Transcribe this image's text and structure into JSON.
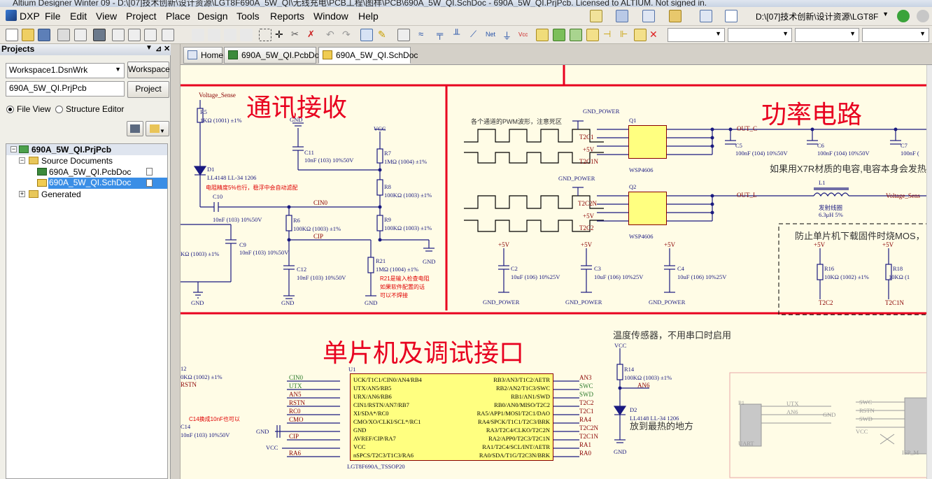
{
  "window": {
    "title": "Altium Designer Winter 09 - D:\\[07]技术创新\\设计资源\\LGT8F690A_5W_QI\\无线充电\\PCB工程\\图样\\PCB\\690A_5W_QI.SchDoc - 690A_5W_QI.PrjPcb. Licensed to ALTIUM. Not signed in."
  },
  "menu": [
    "DXP",
    "File",
    "Edit",
    "View",
    "Project",
    "Place",
    "Design",
    "Tools",
    "Reports",
    "Window",
    "Help"
  ],
  "path_combo": "D:\\[07]技术创新\\设计资源\\LGT8F",
  "projects_panel": {
    "title": "Projects",
    "workspace_value": "Workspace1.DsnWrk",
    "workspace_button": "Workspace",
    "project_value": "690A_5W_QI.PrjPcb",
    "project_button": "Project",
    "file_view": "File View",
    "structure_editor": "Structure Editor",
    "tree": {
      "project": "690A_5W_QI.PrjPcb",
      "source_documents": "Source Documents",
      "pcbdoc": "690A_5W_QI.PcbDoc",
      "schdoc": "690A_5W_QI.SchDoc",
      "generated": "Generated"
    }
  },
  "tabs": [
    "Home",
    "690A_5W_QI.PcbDoc",
    "690A_5W_QI.SchDoc"
  ],
  "schematic": {
    "section_titles": [
      "通讯接收",
      "功率电路",
      "单片机及调试接口"
    ],
    "notes": {
      "pwm": "各个通道的PWM波形，注意死区",
      "x7r": "如果用X7R材质的电容,电容本身会发热",
      "mos": "防止单片机下载固件时烧MOS，",
      "temp": "温度传感器，不用串口时启用",
      "hot": "放到最热的地方",
      "d1_note": "电阻精度5%也行，稳浮中会自动滤配",
      "r21_note1": "R21是输入检查电阻",
      "r21_note2": "如果软件配置的话",
      "r21_note3": "可以不焊接",
      "c14_note": "C14换成10nF也可以"
    },
    "labels": {
      "voltage_sense": "Voltage_Sense",
      "r5": "R5",
      "r5_val": "1KΩ (1001) ±1%",
      "d1": "D1",
      "d1_val": "LL4148 LL-34 1206",
      "gnd": "GND",
      "vcc": "VCC",
      "c11": "C11",
      "c11_val": "10nF (103) 10%50V",
      "r7": "R7",
      "r7_val": "1MΩ (1004) ±1%",
      "r8": "R8",
      "r8_val": "100KΩ (1003) ±1%",
      "r9": "R9",
      "r9_val": "100KΩ (1003) ±1%",
      "c10": "C10",
      "c10_val": "10nF (103) 10%50V",
      "cin0": "CIN0",
      "cip": "CIP",
      "r6": "R6",
      "r6_val": "100KΩ (1003) ±1%",
      "c9": "C9",
      "c9_val": "10nF (103) 10%50V",
      "kq": "KΩ (1003) ±1%",
      "c12": "C12",
      "c12_val": "10nF (103) 10%50V",
      "r21": "R21",
      "r21_val": "1MΩ (1004) ±1%",
      "gnd_power": "GND_POWER",
      "q1": "Q1",
      "q2": "Q2",
      "wsp": "WSP4606",
      "t2c1": "T2C1",
      "t2c1n": "T2C1N",
      "t2c2": "T2C2",
      "t2c2n": "T2C2N",
      "plus5v": "+5V",
      "out_c": "OUT_C",
      "out_l": "OUT_L",
      "c5": "C5",
      "c5_val": "100nF (104) 10%50V",
      "c6": "C6",
      "c6_val": "100nF (104) 10%50V",
      "c7": "C7",
      "c7_val": "100nF (",
      "l1": "L1",
      "l1_val1": "发射线圈",
      "l1_val2": "6.3μH 5%",
      "voltage_sens_r": "Voltage_Sens",
      "c2": "C2",
      "c2_val": "10uF (106) 10%25V",
      "c3": "C3",
      "c3_val": "10uF (106) 10%25V",
      "c4": "C4",
      "c4_val": "10uF (106) 10%25V",
      "r16": "R16",
      "r16_val": "10KΩ (1002) ±1%",
      "r18": "R18",
      "r18_val": "10KΩ (1",
      "r12": "12",
      "r12_val": "0KΩ (1002) ±1%",
      "rstn": "RSTN",
      "c14": "C14",
      "c14_val": "10nF (103) 10%50V",
      "u1": "U1",
      "u1_part": "LGT8F690A_TSSOP20",
      "r14": "R14",
      "r14_val": "100KΩ (1003) ±1%",
      "an6": "AN6",
      "d2": "D2",
      "d2_val": "LL4148 LL-34 1206",
      "p1": "P1",
      "uart": "UART",
      "isp": "ISP_M"
    },
    "u1_left_pins": [
      "UCK/T1C1/CIN0/AN4/RB4",
      "UTX/AN5/RB5",
      "URX/AN6/RB6",
      "CIN1/RSTN/AN7/RB7",
      "XI/SDA*/RC0",
      "CMO/XO/CLKI/SCL*/RC1",
      "GND",
      "AVREF/CIP/RA7",
      "VCC",
      "nSPCS/T2C3/T1C3/RA6"
    ],
    "u1_right_pins": [
      "RB3/AN3/T1C2/AETR",
      "RB2/AN2/T1C3/SWC",
      "RB1/AN1/SWD",
      "RB0/AN0/MISO/T2C2",
      "RA5/APP1/MOSI/T2C1/DAO",
      "RA4/SPCK/T1C1/T2C3/BRK",
      "RA3/T2C4/CLKO/T2C2N",
      "RA2/APP0/T2C3/T2C1N",
      "RA1/T2C4/SCL/INT/AETR",
      "RA0/SDA/T1G/T2C3N/BRK"
    ],
    "u1_left_nets": [
      "CIN0",
      "UTX",
      "AN5",
      "RSTN",
      "RC0",
      "CMO",
      "",
      "CIP",
      "",
      "RA6"
    ],
    "u1_right_nets": [
      "AN3",
      "SWC",
      "SWD",
      "T2C2",
      "T2C1",
      "RA4",
      "T2C2N",
      "T2C1N",
      "RA1",
      "RA0"
    ],
    "gnd_left": "GND",
    "vcc_left": "VCC",
    "p1_pins": [
      "UTX",
      "AN6",
      "GND"
    ],
    "isp_pins": [
      "SWC",
      "RSTN",
      "SWD",
      "VCC"
    ]
  }
}
